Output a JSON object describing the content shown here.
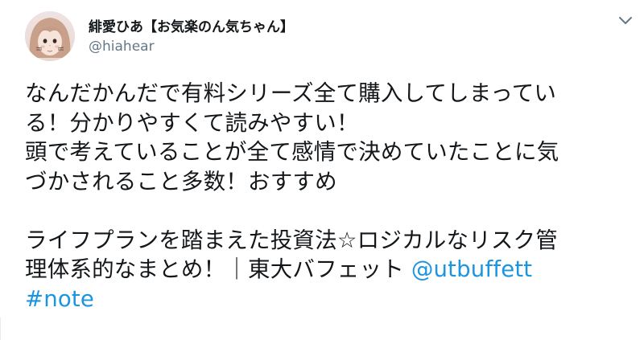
{
  "user": {
    "display_name": "緋愛ひあ【お気楽のん気ちゃん】",
    "handle": "@hiahear",
    "avatar_icon": "avatar-photo"
  },
  "tweet": {
    "lines": [
      "なんだかんだで有料シリーズ全て購入してしまってい",
      "る！分かりやすくて読みやすい！",
      "頭で考えていることが全て感情で決めていたことに気",
      "づかされること多数！おすすめ"
    ],
    "title_line_1": "ライフプランを踏まえた投資法☆ロジカルなリスク管",
    "title_line_2_text": "理体系的なまとめ！｜東大バフェット ",
    "mention": "@utbuffett",
    "hashtag": "#note"
  },
  "menu": {
    "caret_icon": "chevron-down-icon"
  },
  "colors": {
    "text": "#14171a",
    "secondary": "#657786",
    "link": "#1b95e0"
  }
}
